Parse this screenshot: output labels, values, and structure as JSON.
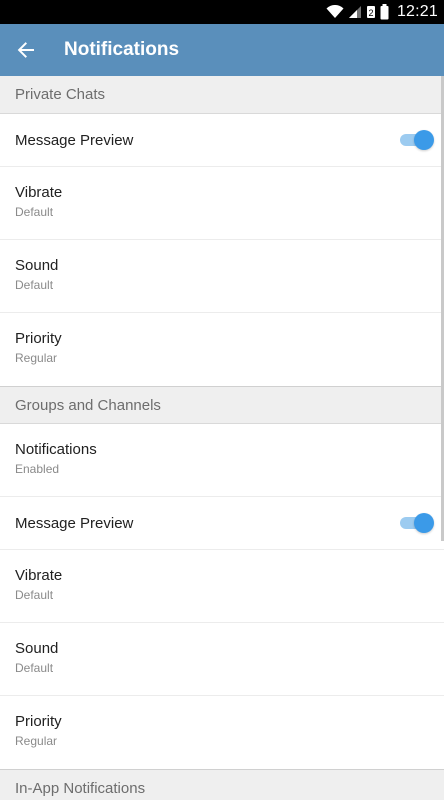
{
  "status_bar": {
    "time": "12:21",
    "icons": [
      "wifi-icon",
      "signal-icon",
      "sim-icon",
      "battery-icon"
    ]
  },
  "app_bar": {
    "title": "Notifications",
    "back_icon": "arrow-back-icon",
    "color": "#5a8fbb"
  },
  "sections": {
    "private": {
      "header": "Private Chats",
      "message_preview": {
        "label": "Message Preview",
        "enabled": true
      },
      "vibrate": {
        "label": "Vibrate",
        "value": "Default"
      },
      "sound": {
        "label": "Sound",
        "value": "Default"
      },
      "priority": {
        "label": "Priority",
        "value": "Regular"
      }
    },
    "groups": {
      "header": "Groups and Channels",
      "notifications": {
        "label": "Notifications",
        "value": "Enabled"
      },
      "message_preview": {
        "label": "Message Preview",
        "enabled": true
      },
      "vibrate": {
        "label": "Vibrate",
        "value": "Default"
      },
      "sound": {
        "label": "Sound",
        "value": "Default"
      },
      "priority": {
        "label": "Priority",
        "value": "Regular"
      }
    },
    "in_app": {
      "header": "In-App Notifications"
    }
  },
  "colors": {
    "accent": "#3b9ae8",
    "toggle_track": "#9ccbf0",
    "section_bg": "#efefef"
  }
}
